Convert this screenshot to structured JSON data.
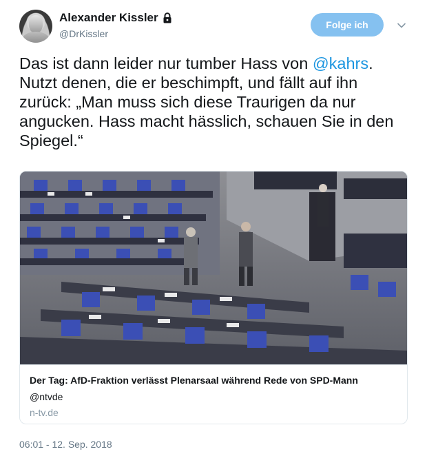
{
  "author": {
    "display_name": "Alexander Kissler",
    "handle": "@DrKissler",
    "avatar_icon": "user-avatar-bust",
    "protected_icon": "lock-icon"
  },
  "follow_button": {
    "label": "Folge ich"
  },
  "menu_icon": "chevron-down-icon",
  "tweet": {
    "text_before": "Das ist dann leider nur tumber Hass von ",
    "mention": "@kahrs",
    "text_after": ". Nutzt denen, die er beschimpft, und fällt auf ihn zurück: „Man muss sich diese Traurigen da nur angucken. Hass macht hässlich, schauen Sie in den Spiegel.“"
  },
  "card": {
    "image_desc": "parliament-plenary-photo",
    "title": "Der Tag: AfD-Fraktion verlässt Plenarsaal während Rede von SPD-Mann",
    "source_handle": "@ntvde",
    "domain": "n-tv.de"
  },
  "timestamp": "06:01 - 12. Sep. 2018",
  "colors": {
    "text": "#14171a",
    "secondary": "#657786",
    "link": "#1b95e0",
    "follow_bg": "#85c1f0",
    "border": "#e1e8ed",
    "seat_blue": "#3b4fb5"
  }
}
